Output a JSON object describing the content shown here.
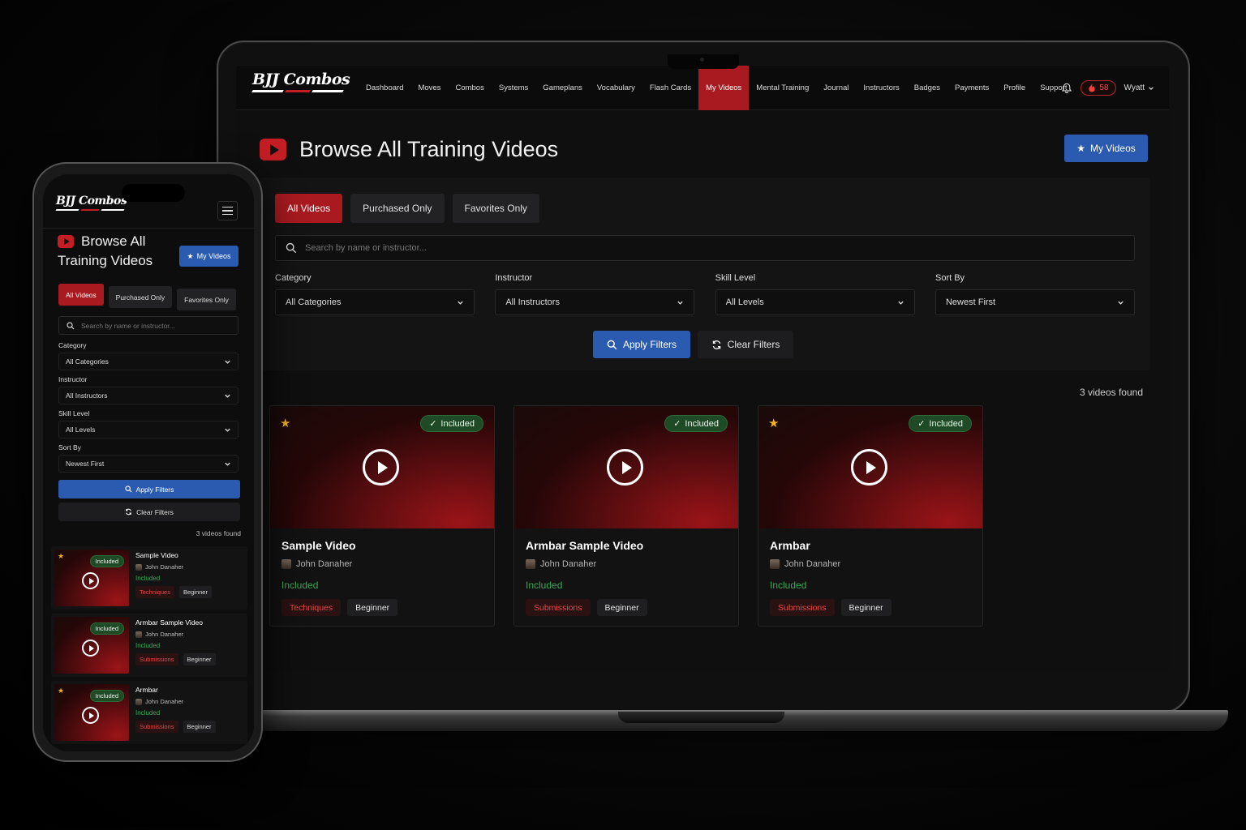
{
  "brand": {
    "name": "BJJ Combos",
    "accent": "#a81a1f",
    "primary_blue": "#2a5bb0",
    "stripe_colors": [
      "#ffffff",
      "#c41e24",
      "#ffffff"
    ]
  },
  "nav": {
    "items": [
      {
        "label": "Dashboard",
        "active": false
      },
      {
        "label": "Moves",
        "active": false
      },
      {
        "label": "Combos",
        "active": false
      },
      {
        "label": "Systems",
        "active": false
      },
      {
        "label": "Gameplans",
        "active": false
      },
      {
        "label": "Vocabulary",
        "active": false
      },
      {
        "label": "Flash Cards",
        "active": false
      },
      {
        "label": "My Videos",
        "active": true
      },
      {
        "label": "Mental Training",
        "active": false
      },
      {
        "label": "Journal",
        "active": false
      },
      {
        "label": "Instructors",
        "active": false
      },
      {
        "label": "Badges",
        "active": false
      },
      {
        "label": "Payments",
        "active": false
      },
      {
        "label": "Profile",
        "active": false
      },
      {
        "label": "Support",
        "active": false
      }
    ],
    "streak_count": "58",
    "user_name": "Wyatt"
  },
  "page": {
    "title": "Browse All Training Videos",
    "title_line1": "Browse All",
    "title_line2": "Training Videos",
    "my_videos_button": "My Videos"
  },
  "filters": {
    "tabs": [
      {
        "label": "All Videos",
        "active": true
      },
      {
        "label": "Purchased Only",
        "active": false
      },
      {
        "label": "Favorites Only",
        "active": false
      }
    ],
    "search_placeholder": "Search by name or instructor...",
    "groups": [
      {
        "label": "Category",
        "value": "All Categories"
      },
      {
        "label": "Instructor",
        "value": "All Instructors"
      },
      {
        "label": "Skill Level",
        "value": "All Levels"
      },
      {
        "label": "Sort By",
        "value": "Newest First"
      }
    ],
    "apply_label": "Apply Filters",
    "clear_label": "Clear Filters"
  },
  "results": {
    "count_text": "3 videos found",
    "videos": [
      {
        "title": "Sample Video",
        "author": "John Danaher",
        "status": "Included",
        "badge": "Included",
        "category": "Techniques",
        "level": "Beginner",
        "favorite": true
      },
      {
        "title": "Armbar Sample Video",
        "author": "John Danaher",
        "status": "Included",
        "badge": "Included",
        "category": "Submissions",
        "level": "Beginner",
        "favorite": false
      },
      {
        "title": "Armbar",
        "author": "John Danaher",
        "status": "Included",
        "badge": "Included",
        "category": "Submissions",
        "level": "Beginner",
        "favorite": true
      }
    ]
  }
}
